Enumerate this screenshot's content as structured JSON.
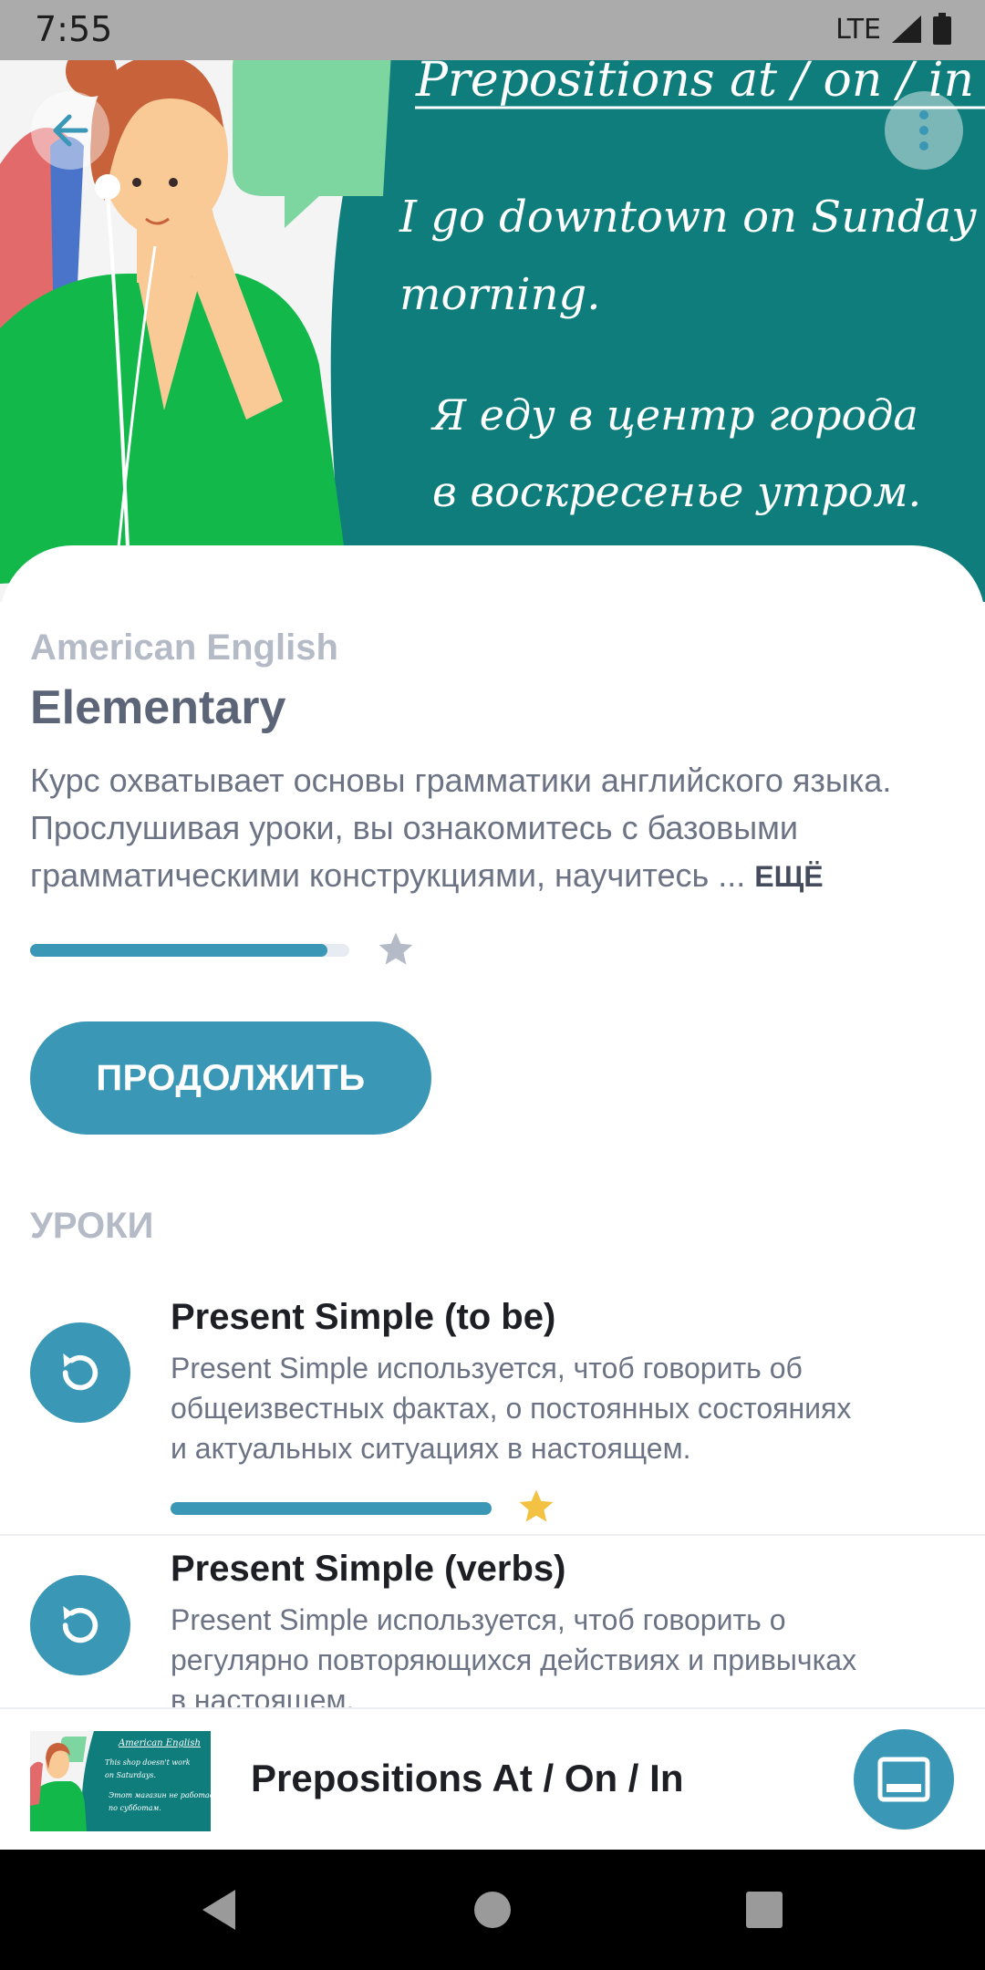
{
  "status_bar": {
    "time": "7:55",
    "network": "LTE"
  },
  "hero": {
    "title": "Prepositions at / on / in",
    "example_en_line1": "I go downtown on Sunday",
    "example_en_line2": "morning.",
    "example_ru_line1": "Я еду в центр города",
    "example_ru_line2": "в воскресенье утром."
  },
  "course": {
    "dialect": "American English",
    "level": "Elementary",
    "description_line1": "Курс охватывает основы грамматики английского языка.",
    "description_line2": "Прослушивая уроки, вы ознакомитесь с базовыми",
    "description_line3": "грамматическими конструкциями, научитесь ...",
    "more_label": "ЕЩЁ",
    "progress": 0.93,
    "continue_label": "ПРОДОЛЖИТЬ"
  },
  "lessons": {
    "section_title": "УРОКИ",
    "items": [
      {
        "title": "Present Simple (to be)",
        "desc_line1": "Present Simple используется, чтоб говорить об",
        "desc_line2": "общеизвестных фактах, о постоянных состояниях",
        "desc_line3": "и актуальных ситуациях в настоящем.",
        "progress": 1.0
      },
      {
        "title": "Present Simple (verbs)",
        "desc_line1": "Present Simple используется, чтоб говорить о",
        "desc_line2": "регулярно повторяющихся действиях и привычках",
        "desc_line3": "в настоящем."
      }
    ]
  },
  "mini_player": {
    "title": "Prepositions At / On / In",
    "thumb_title": "American English",
    "thumb_line1": "This shop doesn't work",
    "thumb_line2": "on Saturdays.",
    "thumb_line3": "Этот магазин не работает",
    "thumb_line4": "по субботам."
  },
  "colors": {
    "accent": "#3a97b6",
    "hero_teal": "#0e7d7b",
    "green": "#0fbf4f",
    "star_active": "#f4c243",
    "star_inactive": "#b4bac6"
  }
}
